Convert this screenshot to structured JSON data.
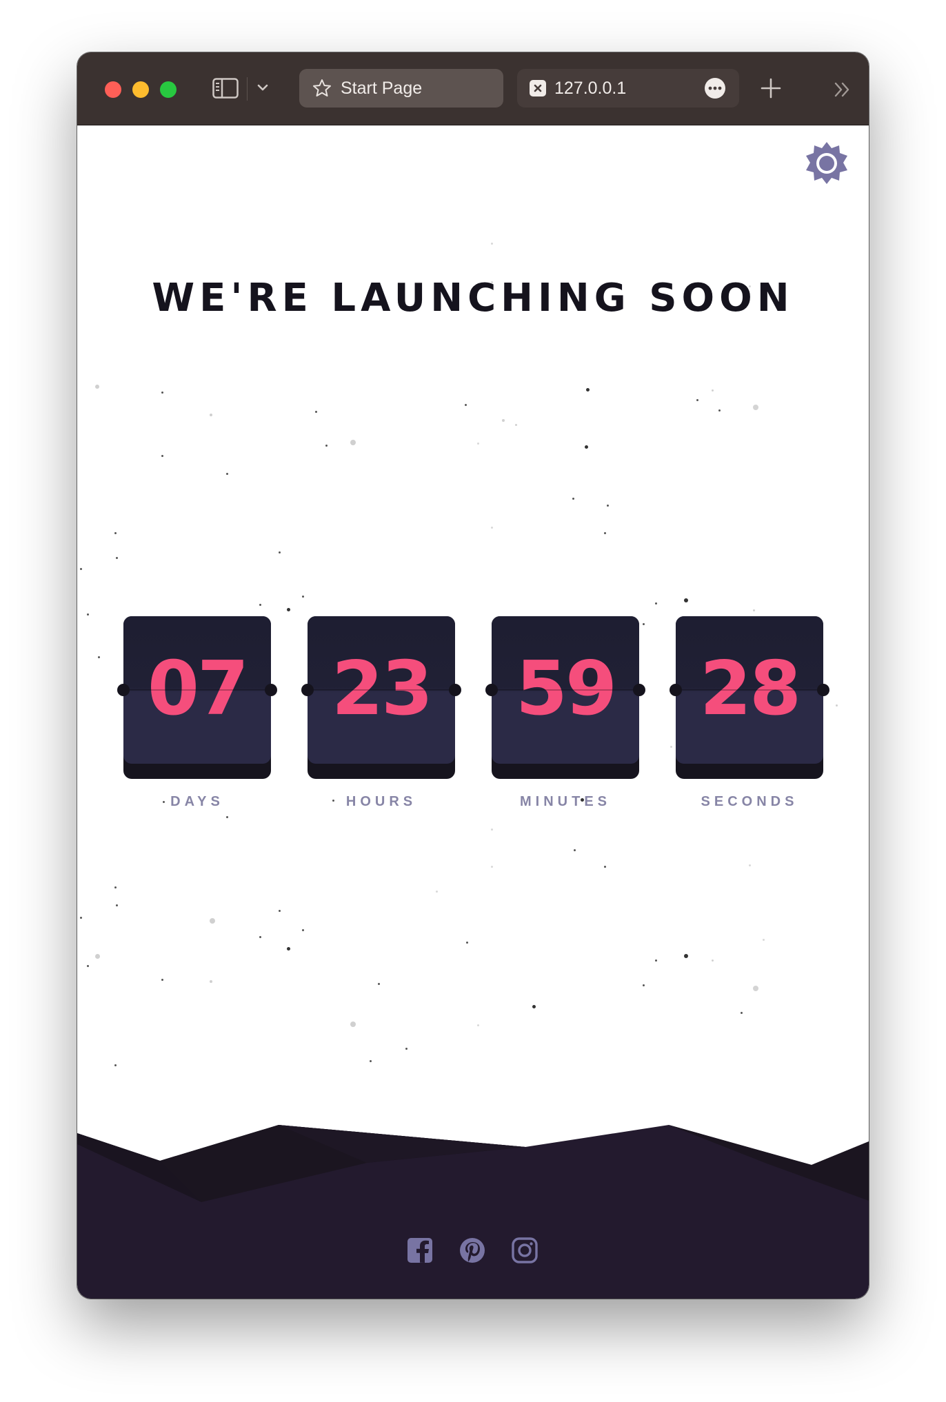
{
  "browser": {
    "active_tab": {
      "label": "Start Page",
      "icon": "star-icon"
    },
    "other_tab": {
      "label": "127.0.0.1",
      "icon": "close-square-icon"
    }
  },
  "page": {
    "headline": "WE'RE LAUNCHING SOON",
    "countdown": [
      {
        "value": "07",
        "unit": "DAYS"
      },
      {
        "value": "23",
        "unit": "HOURS"
      },
      {
        "value": "59",
        "unit": "MINUTES"
      },
      {
        "value": "28",
        "unit": "SECONDS"
      }
    ],
    "social": [
      "facebook-icon",
      "pinterest-icon",
      "instagram-icon"
    ]
  },
  "colors": {
    "digit": "#f54e7c",
    "card": "#2b2a46",
    "label": "#8785a6",
    "hills": "#231a2e",
    "headline": "#15131d"
  }
}
